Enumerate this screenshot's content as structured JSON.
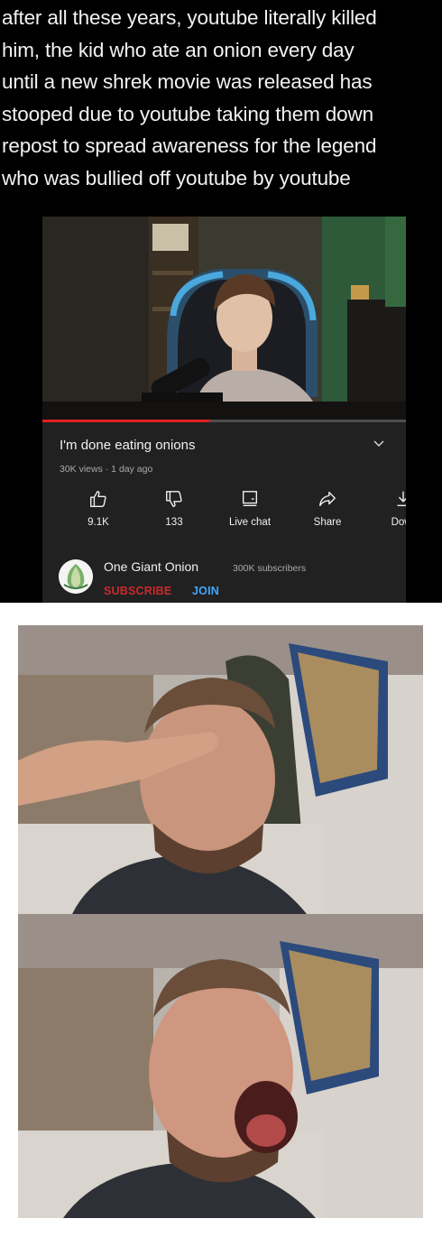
{
  "caption": {
    "lines": [
      "after all these years, youtube literally killed",
      "him, the kid who ate an onion every day",
      "until a new shrek movie was released has",
      "stooped due to youtube taking them down",
      "repost to spread awareness for the legend",
      "who was bullied off youtube by youtube"
    ]
  },
  "video": {
    "title": "I'm done eating onions",
    "meta": "30K views · 1 day ago",
    "progress_fraction": 0.46,
    "actions": [
      {
        "icon": "thumbs-up-icon",
        "label": "9.1K"
      },
      {
        "icon": "thumbs-down-icon",
        "label": "133"
      },
      {
        "icon": "live-chat-icon",
        "label": "Live chat"
      },
      {
        "icon": "share-icon",
        "label": "Share"
      },
      {
        "icon": "download-icon",
        "label": "Dowr"
      }
    ]
  },
  "channel": {
    "name": "One Giant Onion",
    "subscribers": "300K subscribers",
    "subscribe_label": "SUBSCRIBE",
    "join_label": "JOIN"
  },
  "colors": {
    "subscribe": "#cc2a2a",
    "join": "#3ea6ff",
    "progress": "#e02020",
    "card_background": "#212121"
  }
}
